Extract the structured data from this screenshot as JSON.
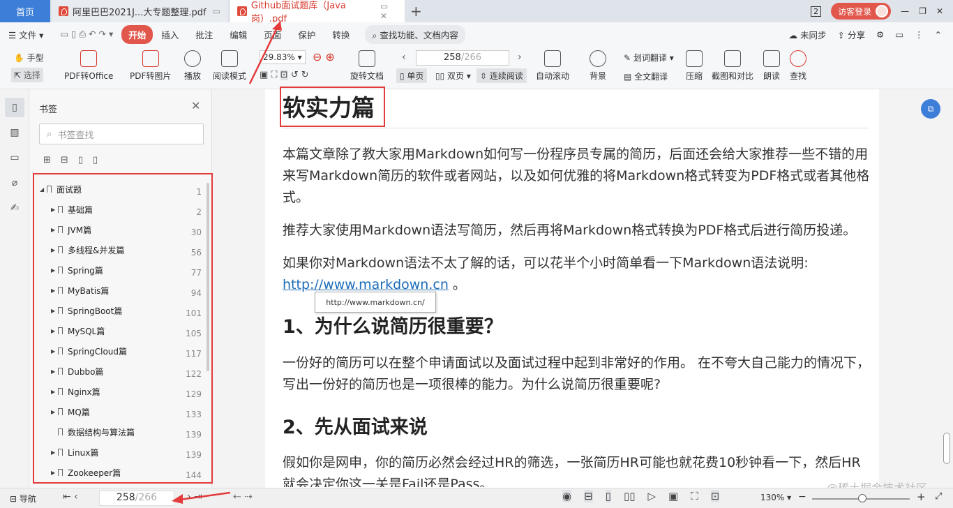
{
  "tabs": {
    "home": "首页",
    "tab1": "阿里巴巴2021J...大专题整理.pdf",
    "tab2": "Github面试题库（Java岗）.pdf",
    "new": "+",
    "badge": "2",
    "login": "访客登录"
  },
  "menu": {
    "file": "文件",
    "items": [
      "开始",
      "插入",
      "批注",
      "编辑",
      "页面",
      "保护",
      "转换"
    ],
    "search": "查找功能、文档内容",
    "sync": "未同步",
    "share": "分享"
  },
  "toolbar": {
    "hand": "手型",
    "select": "选择",
    "pdf_to_office": "PDF转Office",
    "pdf_to_image": "PDF转图片",
    "play": "播放",
    "read_mode": "阅读模式",
    "zoom": "29.83%",
    "rotate": "旋转文档",
    "page": "258",
    "page_total": "/266",
    "single": "单页",
    "double": "双页",
    "continuous": "连续阅读",
    "autoscroll": "自动滚动",
    "background": "背景",
    "word_translate": "划词翻译",
    "full_translate": "全文翻译",
    "compress": "压缩",
    "screenshot_compare": "截图和对比",
    "read_aloud": "朗读",
    "find": "查找"
  },
  "panel": {
    "title": "书签",
    "search_placeholder": "书签查找",
    "bookmarks": [
      {
        "label": "面试题",
        "page": "1",
        "level": 0
      },
      {
        "label": "基础篇",
        "page": "2",
        "level": 1
      },
      {
        "label": "JVM篇",
        "page": "30",
        "level": 1
      },
      {
        "label": "多线程&并发篇",
        "page": "56",
        "level": 1
      },
      {
        "label": "Spring篇",
        "page": "77",
        "level": 1
      },
      {
        "label": "MyBatis篇",
        "page": "94",
        "level": 1
      },
      {
        "label": "SpringBoot篇",
        "page": "101",
        "level": 1
      },
      {
        "label": "MySQL篇",
        "page": "105",
        "level": 1
      },
      {
        "label": "SpringCloud篇",
        "page": "117",
        "level": 1
      },
      {
        "label": "Dubbo篇",
        "page": "122",
        "level": 1
      },
      {
        "label": "Nginx篇",
        "page": "129",
        "level": 1
      },
      {
        "label": "MQ篇",
        "page": "133",
        "level": 1
      },
      {
        "label": "数据结构与算法篇",
        "page": "139",
        "level": 1,
        "noarrow": true
      },
      {
        "label": "Linux篇",
        "page": "139",
        "level": 1
      },
      {
        "label": "Zookeeper篇",
        "page": "144",
        "level": 1
      }
    ]
  },
  "doc": {
    "h1": "软实力篇",
    "p1": "本篇文章除了教大家用Markdown如何写一份程序员专属的简历，后面还会给大家推荐一些不错的用来写Markdown简历的软件或者网站，以及如何优雅的将Markdown格式转变为PDF格式或者其他格式。",
    "p2": "推荐大家使用Markdown语法写简历，然后再将Markdown格式转换为PDF格式后进行简历投递。",
    "p3": "如果你对Markdown语法不太了解的话，可以花半个小时简单看一下Markdown语法说明:",
    "link": "http://www.markdown.cn",
    "link_after": " 。",
    "tooltip": "http://www.markdown.cn/",
    "h2a": "1、为什么说简历很重要？",
    "p4": "一份好的简历可以在整个申请面试以及面试过程中起到非常好的作用。 在不夸大自己能力的情况下，写出一份好的简历也是一项很棒的能力。为什么说简历很重要呢?",
    "h2b": "2、先从面试来说",
    "p5": "假如你是网申，你的简历必然会经过HR的筛选，一张简历HR可能也就花费10秒钟看一下，然后HR就会决定你这一关是Fail还是Pass。"
  },
  "status": {
    "nav": "导航",
    "page": "258",
    "page_total": "/266",
    "zoom": "130%",
    "watermark": "@稀土掘金技术社区"
  },
  "colors": {
    "accent": "#e2574c",
    "highlight": "#e33a3a",
    "tabblue": "#3d7ed8",
    "link": "#1a6bb8"
  }
}
